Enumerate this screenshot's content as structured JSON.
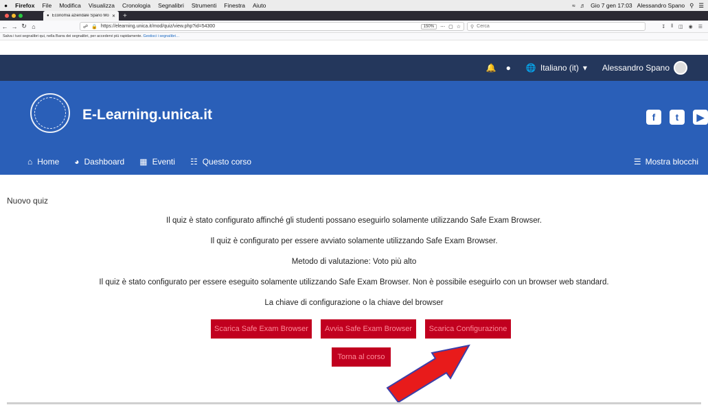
{
  "macmenu": {
    "apple": "",
    "items": [
      "Firefox",
      "File",
      "Modifica",
      "Visualizza",
      "Cronologia",
      "Segnalibri",
      "Strumenti",
      "Finestra",
      "Aiuto"
    ],
    "clock": "Gio 7 gen 17:03",
    "user": "Alessandro Spano"
  },
  "tab": {
    "title": "Economia aziendale Spano Mo"
  },
  "nav": {
    "url": "https://elearning.unica.it/mod/quiz/view.php?id=54300",
    "zoom": "150%",
    "search_placeholder": "Cerca"
  },
  "bookmarks": {
    "text": "Salva i tuoi segnalibri qui, nella Barra dei segnalibri, per accedervi più rapidamente.",
    "link": "Gestisci i segnalibri…"
  },
  "topnav": {
    "language": "Italiano (it)",
    "user": "Alessandro Spano"
  },
  "header": {
    "site_name": "E-Learning.unica.it"
  },
  "menu": {
    "home": "Home",
    "dashboard": "Dashboard",
    "events": "Eventi",
    "course": "Questo corso",
    "blocks": "Mostra blocchi"
  },
  "content": {
    "page_title": "Nuovo quiz",
    "lines": [
      "Il quiz è stato configurato affinché gli studenti possano eseguirlo solamente utilizzando Safe Exam Browser.",
      "Il quiz è configurato per essere avviato solamente utilizzando Safe Exam Browser.",
      "Metodo di valutazione: Voto più alto",
      "Il quiz è stato configurato per essere eseguito solamente utilizzando Safe Exam Browser. Non è possibile eseguirlo con un browser web standard.",
      "La chiave di configurazione o la chiave del browser"
    ],
    "buttons": {
      "download_seb": "Scarica Safe Exam Browser",
      "launch_seb": "Avvia Safe Exam Browser",
      "download_config": "Scarica Configurazione",
      "back": "Torna al corso"
    }
  },
  "colors": {
    "topnav": "#24375c",
    "header": "#2a5fb8",
    "button": "#c1001f",
    "arrow": "#e81b1b"
  }
}
